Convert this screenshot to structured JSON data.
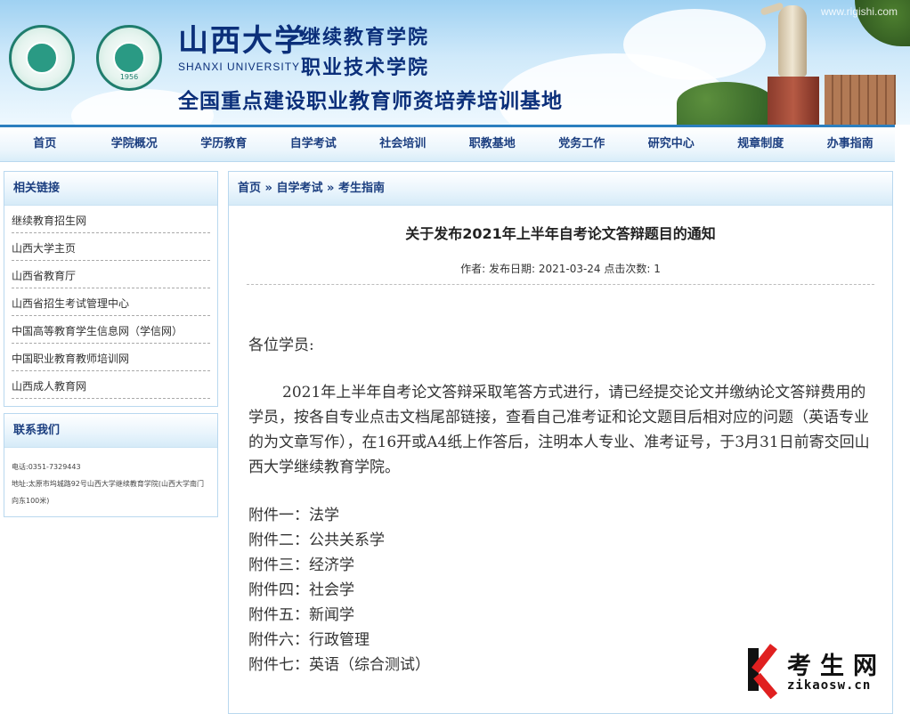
{
  "header": {
    "school_cn": "山西大学",
    "school_en": "SHANXI UNIVERSITY",
    "college_1": "继续教育学院",
    "college_2": "职业技术学院",
    "base_title": "全国重点建设职业教育师资培养培训基地",
    "logo_year": "1956",
    "watermark": "www.rigishi.com"
  },
  "nav": {
    "items": [
      "首页",
      "学院概况",
      "学历教育",
      "自学考试",
      "社会培训",
      "职教基地",
      "党务工作",
      "研究中心",
      "规章制度",
      "办事指南"
    ]
  },
  "sidebar": {
    "links_title": "相关链接",
    "links": [
      "继续教育招生网",
      "山西大学主页",
      "山西省教育厅",
      "山西省招生考试管理中心",
      "中国高等教育学生信息网（学信网）",
      "中国职业教育教师培训网",
      "山西成人教育网"
    ],
    "contact_title": "联系我们",
    "phone": "电话:0351-7329443",
    "address": "地址:太原市坞城路92号山西大学继续教育学院(山西大学南门向东100米)"
  },
  "breadcrumb": {
    "home": "首页",
    "sep": "»",
    "level2": "自学考试",
    "level3": "考生指南"
  },
  "article": {
    "title": "关于发布2021年上半年自考论文答辩题目的通知",
    "meta": "作者:  发布日期: 2021-03-24 点击次数: 1",
    "greeting": "各位学员:",
    "body": "2021年上半年自考论文答辩采取笔答方式进行，请已经提交论文并缴纳论文答辩费用的学员，按各自专业点击文档尾部链接，查看自己准考证和论文题目后相对应的问题（英语专业的为文章写作），在16开或A4纸上作答后，注明本人专业、准考证号，于3月31日前寄交回山西大学继续教育学院。",
    "attachments": [
      "附件一：法学",
      "附件二：公共关系学",
      "附件三：经济学",
      "附件四：社会学",
      "附件五：新闻学",
      "附件六：行政管理",
      "附件七：英语（综合测试）"
    ]
  },
  "site_logo": {
    "cn": "考生网",
    "en": "zikaosw.cn"
  },
  "colors": {
    "nav_text": "#1c3f80",
    "nav_border": "#2c7fbf",
    "banner_title": "#0b2f7a"
  }
}
